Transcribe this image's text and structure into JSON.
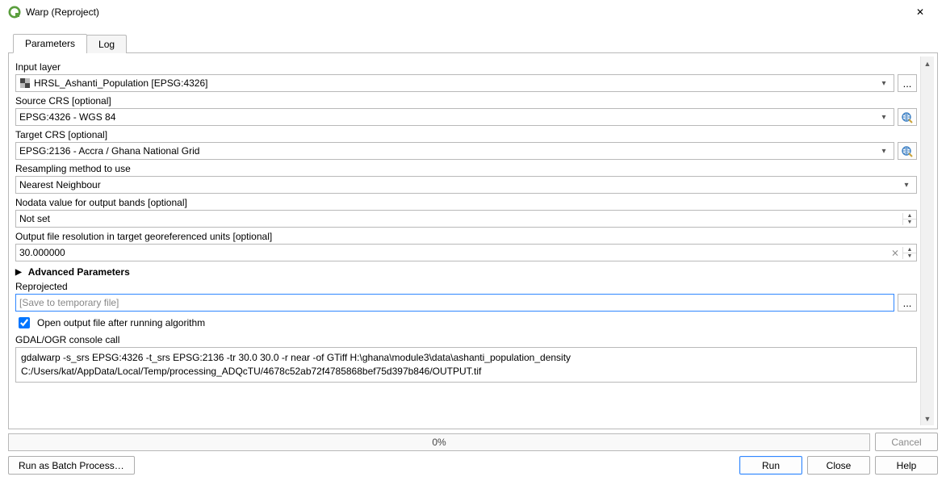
{
  "window": {
    "title": "Warp (Reproject)"
  },
  "tabs": {
    "parameters": "Parameters",
    "log": "Log"
  },
  "labels": {
    "input_layer": "Input layer",
    "source_crs": "Source CRS [optional]",
    "target_crs": "Target CRS [optional]",
    "resampling": "Resampling method to use",
    "nodata": "Nodata value for output bands [optional]",
    "resolution": "Output file resolution in target georeferenced units [optional]",
    "advanced": "Advanced Parameters",
    "reprojected": "Reprojected",
    "open_output": "Open output file after running algorithm",
    "console_call": "GDAL/OGR console call"
  },
  "values": {
    "input_layer": "HRSL_Ashanti_Population [EPSG:4326]",
    "source_crs": "EPSG:4326 - WGS 84",
    "target_crs": "EPSG:2136 - Accra / Ghana National Grid",
    "resampling": "Nearest Neighbour",
    "nodata": "Not set",
    "resolution": "30.000000",
    "reprojected_placeholder": "[Save to temporary file]",
    "open_output_checked": true,
    "console": "gdalwarp -s_srs EPSG:4326 -t_srs EPSG:2136 -tr 30.0 30.0 -r near -of GTiff H:\\ghana\\module3\\data\\ashanti_population_density C:/Users/kat/AppData/Local/Temp/processing_ADQcTU/4678c52ab72f4785868bef75d397b846/OUTPUT.tif"
  },
  "progress": {
    "text": "0%",
    "value": 0
  },
  "buttons": {
    "cancel": "Cancel",
    "batch": "Run as Batch Process…",
    "run": "Run",
    "close": "Close",
    "help": "Help"
  },
  "icons": {
    "browse": "...",
    "crs_picker": "crs",
    "close_x": "✕",
    "chevron_down": "▾",
    "spin_up": "▲",
    "spin_down": "▼",
    "scroll_up": "▲",
    "scroll_down": "▼",
    "tri_right": "▶",
    "clear_x": "⨯"
  }
}
